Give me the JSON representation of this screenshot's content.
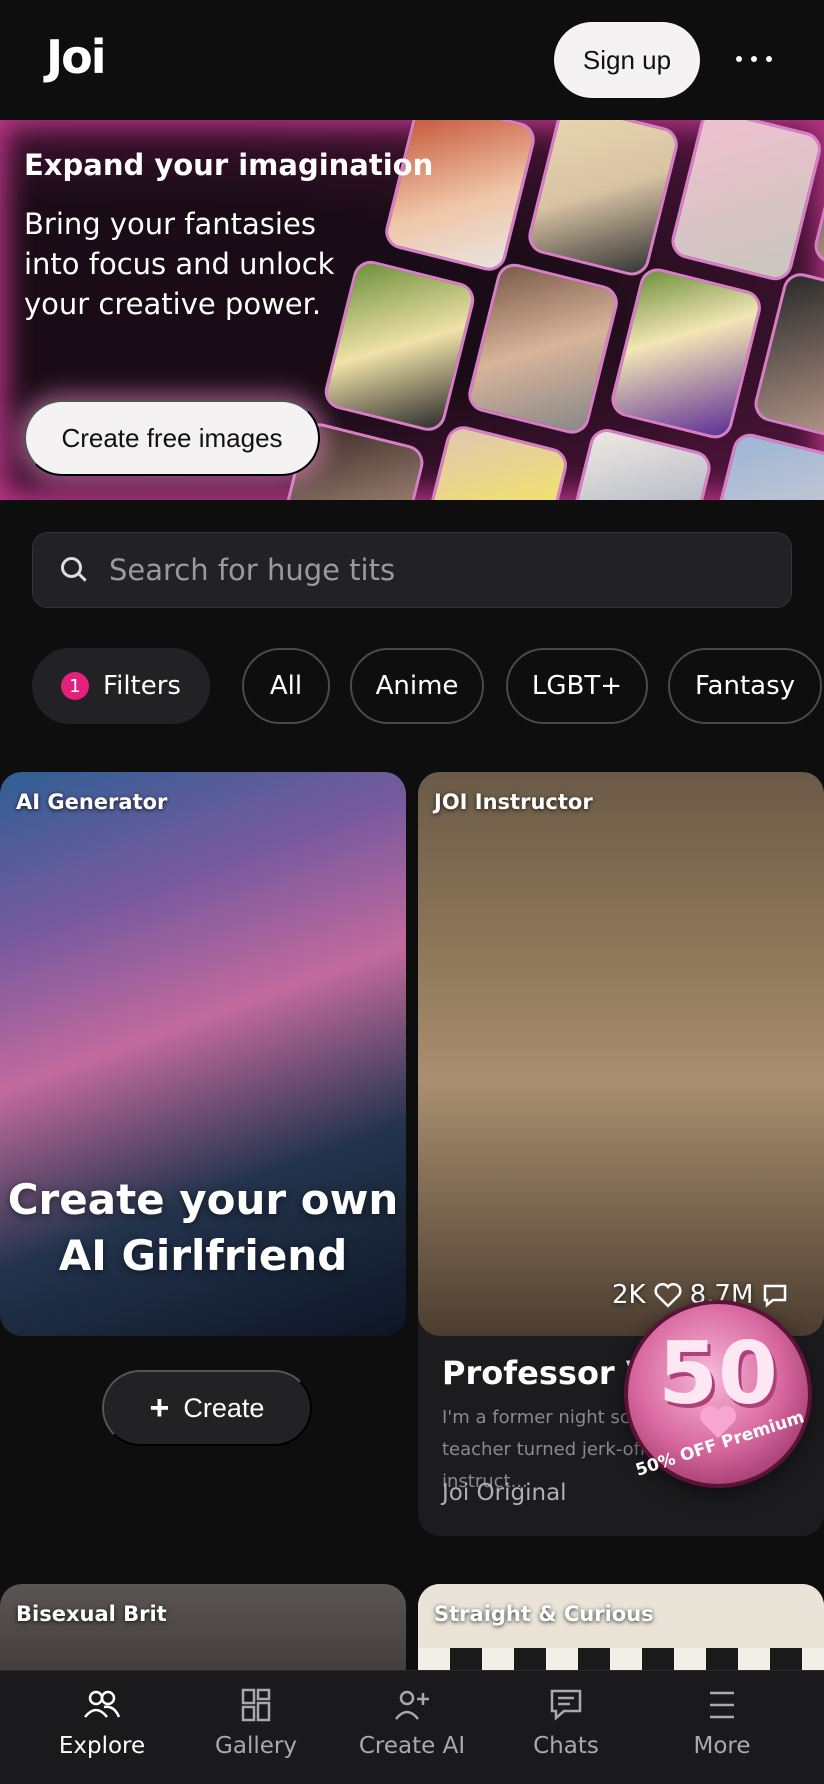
{
  "header": {
    "logo": "Joi",
    "signup_label": "Sign up",
    "more_icon": "more-dots-icon"
  },
  "hero": {
    "title": "Expand your imagination",
    "subtitle": "Bring your fantasies into focus and unlock your creative power.",
    "cta_label": "Create free images",
    "accent_color": "#c0388c"
  },
  "search": {
    "placeholder": "Search for huge tits",
    "icon": "search-icon"
  },
  "chips": {
    "filters_label": "Filters",
    "filters_count": "1",
    "items": [
      "All",
      "Anime",
      "LGBT+",
      "Fantasy"
    ]
  },
  "cards": {
    "generator": {
      "tag": "AI Generator",
      "title": "Create your own AI Girlfriend",
      "create_label": "Create"
    },
    "instructor": {
      "tag": "JOI Instructor",
      "likes": "2K",
      "messages": "8.7M",
      "name": "Professor Val",
      "description": "I'm a former night school teacher turned jerk-off instruct...",
      "source": "Joi Original"
    },
    "promo": {
      "number": "50",
      "text": "50% OFF Premium"
    },
    "lower": [
      {
        "tag": "Bisexual Brit"
      },
      {
        "tag": "Straight & Curious"
      }
    ]
  },
  "nav": {
    "items": [
      {
        "label": "Explore",
        "icon": "explore-people-icon",
        "active": true
      },
      {
        "label": "Gallery",
        "icon": "gallery-grid-icon",
        "active": false
      },
      {
        "label": "Create AI",
        "icon": "create-ai-icon",
        "active": false
      },
      {
        "label": "Chats",
        "icon": "chat-bubble-icon",
        "active": false
      },
      {
        "label": "More",
        "icon": "menu-lines-icon",
        "active": false
      }
    ]
  }
}
